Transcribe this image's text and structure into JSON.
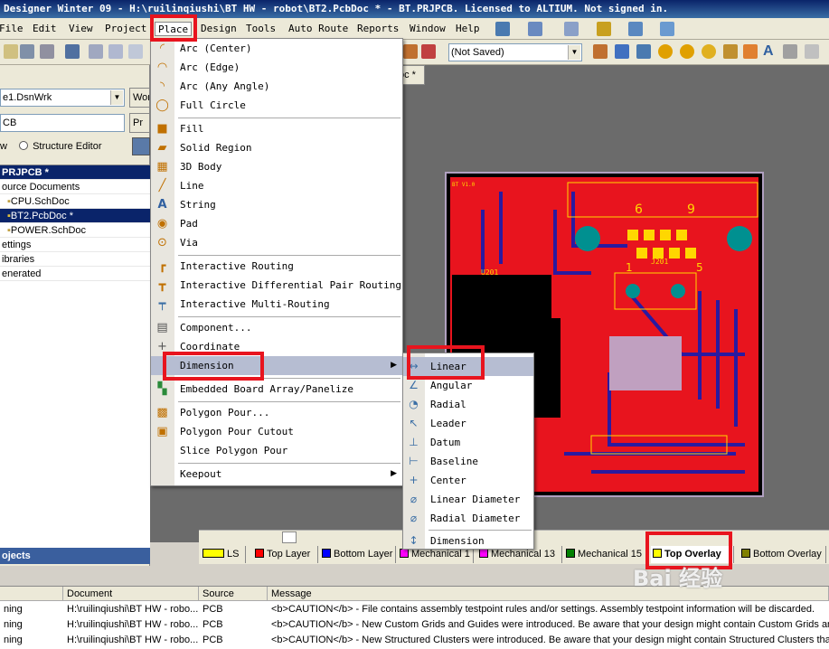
{
  "app": {
    "title": "Designer Winter 09 - H:\\ruilinqiushi\\BT HW - robot\\BT2.PcbDoc * - BT.PRJPCB. Licensed to ALTIUM. Not signed in."
  },
  "menubar": {
    "items": [
      {
        "label": "File",
        "hot": "F"
      },
      {
        "label": "Edit",
        "hot": "E"
      },
      {
        "label": "View",
        "hot": "V"
      },
      {
        "label": "Project",
        "hot": "C"
      },
      {
        "label": "Place",
        "hot": "P"
      },
      {
        "label": "Design",
        "hot": "D"
      },
      {
        "label": "Tools",
        "hot": "T"
      },
      {
        "label": "Auto Route",
        "hot": "A"
      },
      {
        "label": "Reports",
        "hot": "R"
      },
      {
        "label": "Window",
        "hot": "W"
      },
      {
        "label": "Help",
        "hot": "H"
      }
    ]
  },
  "toolbar": {
    "variant_combo": "(Not Saved)"
  },
  "left_panel": {
    "workspace_combo": "e1.DsnWrk",
    "workspace_button": "Wor",
    "project_combo": "CB",
    "project_button": "Pr",
    "view_radio": "w",
    "structure_editor": "Structure Editor",
    "tree": [
      {
        "label": "PRJPCB *",
        "state": "selected"
      },
      {
        "label": "ource Documents",
        "state": ""
      },
      {
        "label": "CPU.SchDoc",
        "state": ""
      },
      {
        "label": "BT2.PcbDoc *",
        "state": "highlight"
      },
      {
        "label": "POWER.SchDoc",
        "state": ""
      },
      {
        "label": "ettings",
        "state": ""
      },
      {
        "label": "ibraries",
        "state": ""
      },
      {
        "label": "enerated",
        "state": ""
      }
    ],
    "projects_tab": "ojects"
  },
  "document_tab": "oc *",
  "place_menu": {
    "items": [
      {
        "label": "Arc (Center)",
        "icon": "arc-center-icon",
        "glyph": "◜"
      },
      {
        "label": "Arc (Edge)",
        "icon": "arc-edge-icon",
        "glyph": "◠"
      },
      {
        "label": "Arc (Any Angle)",
        "icon": "arc-any-angle-icon",
        "glyph": "◝"
      },
      {
        "label": "Full Circle",
        "icon": "full-circle-icon",
        "glyph": "◯"
      },
      {
        "label": "Fill",
        "icon": "fill-icon",
        "glyph": "■"
      },
      {
        "label": "Solid Region",
        "icon": "solid-region-icon",
        "glyph": "▰"
      },
      {
        "label": "3D Body",
        "icon": "3d-body-icon",
        "glyph": "▦"
      },
      {
        "label": "Line",
        "icon": "line-icon",
        "glyph": "╱"
      },
      {
        "label": "String",
        "icon": "string-icon",
        "glyph": "A"
      },
      {
        "label": "Pad",
        "icon": "pad-icon",
        "glyph": "◉"
      },
      {
        "label": "Via",
        "icon": "via-icon",
        "glyph": "⊙"
      },
      {
        "label": "Interactive Routing",
        "icon": "interactive-routing-icon",
        "glyph": "┏"
      },
      {
        "label": "Interactive Differential Pair Routing",
        "icon": "diff-pair-routing-icon",
        "glyph": "┳"
      },
      {
        "label": "Interactive Multi-Routing",
        "icon": "multi-routing-icon",
        "glyph": "┯"
      },
      {
        "label": "Component...",
        "icon": "component-icon",
        "glyph": "▤"
      },
      {
        "label": "Coordinate",
        "icon": "coordinate-icon",
        "glyph": "+"
      },
      {
        "label": "Dimension",
        "icon": "dimension-icon",
        "glyph": ""
      },
      {
        "label": "Embedded Board Array/Panelize",
        "icon": "board-array-icon",
        "glyph": "▚"
      },
      {
        "label": "Polygon Pour...",
        "icon": "polygon-pour-icon",
        "glyph": "▩"
      },
      {
        "label": "Polygon Pour Cutout",
        "icon": "polygon-cutout-icon",
        "glyph": "▣"
      },
      {
        "label": "Slice Polygon Pour",
        "icon": "slice-polygon-icon",
        "glyph": ""
      },
      {
        "label": "Keepout",
        "icon": "keepout-icon",
        "glyph": ""
      }
    ]
  },
  "dimension_menu": {
    "items": [
      {
        "label": "Linear",
        "icon": "linear-dimension-icon",
        "glyph": "↔"
      },
      {
        "label": "Angular",
        "icon": "angular-dimension-icon",
        "glyph": "∠"
      },
      {
        "label": "Radial",
        "icon": "radial-dimension-icon",
        "glyph": "◔"
      },
      {
        "label": "Leader",
        "icon": "leader-icon",
        "glyph": "↖"
      },
      {
        "label": "Datum",
        "icon": "datum-icon",
        "glyph": "⊥"
      },
      {
        "label": "Baseline",
        "icon": "baseline-icon",
        "glyph": "⊢"
      },
      {
        "label": "Center",
        "icon": "center-icon",
        "glyph": "+"
      },
      {
        "label": "Linear Diameter",
        "icon": "linear-diameter-icon",
        "glyph": "⌀"
      },
      {
        "label": "Radial Diameter",
        "icon": "radial-diameter-icon",
        "glyph": "⌀"
      },
      {
        "label": "Dimension",
        "icon": "dimension-generic-icon",
        "glyph": "↕"
      }
    ]
  },
  "layer_tabs": [
    {
      "label": "LS",
      "color": "#ffff00"
    },
    {
      "label": "Top Layer",
      "color": "#ff0000"
    },
    {
      "label": "Bottom Layer",
      "color": "#0000ff"
    },
    {
      "label": "Mechanical 1",
      "color": "#ff00ff"
    },
    {
      "label": "Mechanical 13",
      "color": "#ff00ff"
    },
    {
      "label": "Mechanical 15",
      "color": "#008000"
    },
    {
      "label": "Top Overlay",
      "color": "#ffff00"
    },
    {
      "label": "Bottom Overlay",
      "color": "#808000"
    }
  ],
  "messages": {
    "headers": {
      "c1": "",
      "c2": "Document",
      "c3": "Source",
      "c4": "Message"
    },
    "rows": [
      {
        "class": "ning",
        "document": "H:\\ruilinqiushi\\BT HW - robo...",
        "source": "PCB",
        "message": "<b>CAUTION</b> - File contains assembly testpoint rules and/or settings.  Assembly testpoint information will be discarded."
      },
      {
        "class": "ning",
        "document": "H:\\ruilinqiushi\\BT HW - robo...",
        "source": "PCB",
        "message": "<b>CAUTION</b> - New Custom Grids and Guides were introduced. Be aware that your design might contain Custom Grids and Gu"
      },
      {
        "class": "ning",
        "document": "H:\\ruilinqiushi\\BT HW - robo...",
        "source": "PCB",
        "message": "<b>CAUTION</b> - New Structured Clusters were introduced. Be aware that your design might contain Structured Clusters that c"
      }
    ]
  },
  "pcb_labels": {
    "board_name": "BT V1.0",
    "connector_left": "6",
    "connector_right": "9",
    "pin_one": "1",
    "pin_five": "5",
    "ref_connector": "J201",
    "ref_mcu": "U201"
  },
  "watermark": "Bai 经验",
  "colors": {
    "accent_red": "#e8141e",
    "menu_highlight": "#b6bdd2",
    "title_bar": "#0a246a"
  }
}
